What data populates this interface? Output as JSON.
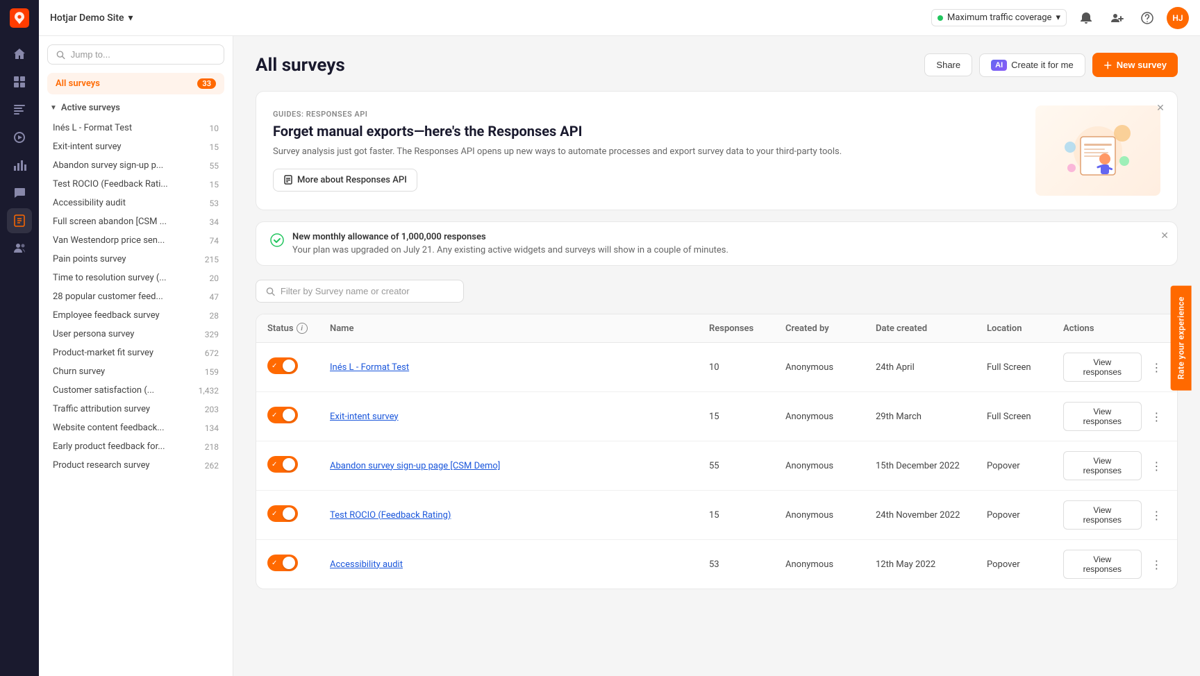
{
  "app": {
    "name": "hotjar",
    "logo_text": "hotjar"
  },
  "topbar": {
    "site_name": "Hotjar Demo Site",
    "traffic_coverage": "Maximum traffic coverage",
    "traffic_active": true
  },
  "sidebar": {
    "search_placeholder": "Jump to...",
    "all_surveys_label": "All surveys",
    "all_surveys_count": "33",
    "active_surveys_header": "Active surveys",
    "items": [
      {
        "name": "Inés L - Format Test",
        "count": "10"
      },
      {
        "name": "Exit-intent survey",
        "count": "15"
      },
      {
        "name": "Abandon survey sign-up p...",
        "count": "55"
      },
      {
        "name": "Test ROCIO (Feedback Rati...",
        "count": "15"
      },
      {
        "name": "Accessibility audit",
        "count": "53"
      },
      {
        "name": "Full screen abandon [CSM ...",
        "count": "34"
      },
      {
        "name": "Van Westendorp price sen...",
        "count": "74"
      },
      {
        "name": "Pain points survey",
        "count": "215"
      },
      {
        "name": "Time to resolution survey (...",
        "count": "20"
      },
      {
        "name": "28 popular customer feed...",
        "count": "47"
      },
      {
        "name": "Employee feedback survey",
        "count": "28"
      },
      {
        "name": "User persona survey",
        "count": "329"
      },
      {
        "name": "Product-market fit survey",
        "count": "672"
      },
      {
        "name": "Churn survey",
        "count": "159"
      },
      {
        "name": "Customer satisfaction (...",
        "count": "1,432"
      },
      {
        "name": "Traffic attribution survey",
        "count": "203"
      },
      {
        "name": "Website content feedback...",
        "count": "134"
      },
      {
        "name": "Early product feedback for...",
        "count": "218"
      },
      {
        "name": "Product research survey",
        "count": "262"
      }
    ]
  },
  "page": {
    "title": "All surveys",
    "share_label": "Share",
    "ai_label": "Create it for me",
    "ai_badge": "AI",
    "new_survey_label": "New survey"
  },
  "banner": {
    "guide_label": "GUIDES: RESPONSES API",
    "title": "Forget manual exports—here's the Responses API",
    "description": "Survey analysis just got faster. The Responses API opens up new ways to automate processes and export survey data to your third-party tools.",
    "cta_label": "More about Responses API"
  },
  "alert": {
    "title": "New monthly allowance of 1,000,000 responses",
    "description": "Your plan was upgraded on July 21. Any existing active widgets and surveys will show in a couple of minutes."
  },
  "filter": {
    "placeholder": "Filter by Survey name or creator"
  },
  "table": {
    "columns": {
      "status": "Status",
      "name": "Name",
      "responses": "Responses",
      "created_by": "Created by",
      "date_created": "Date created",
      "location": "Location",
      "actions": "Actions"
    },
    "view_responses_label": "View responses",
    "rows": [
      {
        "id": 1,
        "active": true,
        "name": "Inés L - Format Test",
        "responses": "10",
        "created_by": "Anonymous",
        "date_created": "24th April",
        "location": "Full Screen"
      },
      {
        "id": 2,
        "active": true,
        "name": "Exit-intent survey",
        "responses": "15",
        "created_by": "Anonymous",
        "date_created": "29th March",
        "location": "Full Screen"
      },
      {
        "id": 3,
        "active": true,
        "name": "Abandon survey sign-up page [CSM Demo]",
        "responses": "55",
        "created_by": "Anonymous",
        "date_created": "15th December 2022",
        "location": "Popover"
      },
      {
        "id": 4,
        "active": true,
        "name": "Test ROCIO (Feedback Rating)",
        "responses": "15",
        "created_by": "Anonymous",
        "date_created": "24th November 2022",
        "location": "Popover"
      },
      {
        "id": 5,
        "active": true,
        "name": "Accessibility audit",
        "responses": "53",
        "created_by": "Anonymous",
        "date_created": "12th May 2022",
        "location": "Popover"
      }
    ]
  },
  "feedback_tab": "Rate your experience",
  "nav_icons": [
    {
      "name": "home-icon",
      "symbol": "⌂"
    },
    {
      "name": "grid-icon",
      "symbol": "⊞"
    },
    {
      "name": "message-icon",
      "symbol": "💬"
    },
    {
      "name": "funnel-icon",
      "symbol": "⬡"
    },
    {
      "name": "chart-icon",
      "symbol": "📊"
    },
    {
      "name": "activity-icon",
      "symbol": "📋"
    },
    {
      "name": "survey-icon",
      "symbol": "📝"
    },
    {
      "name": "people-icon",
      "symbol": "👤"
    }
  ]
}
